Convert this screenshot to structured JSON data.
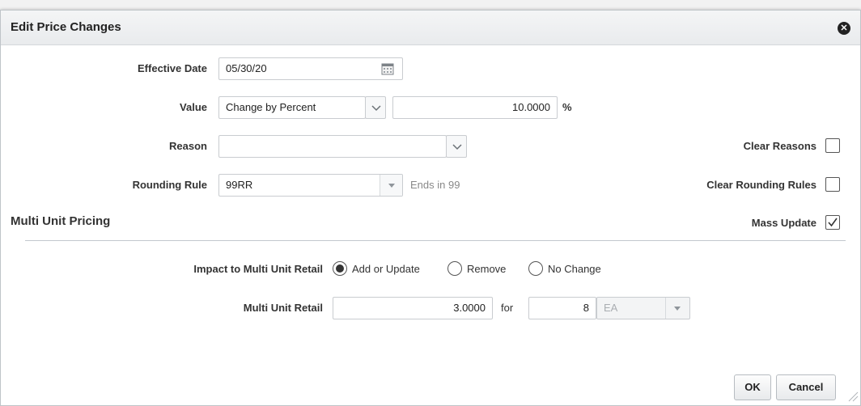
{
  "dialog": {
    "title": "Edit Price Changes",
    "close_glyph": "✕"
  },
  "form": {
    "effective_date": {
      "label": "Effective Date",
      "value": "05/30/20"
    },
    "value": {
      "label": "Value",
      "type_selected": "Change by Percent",
      "amount": "10.0000",
      "unit": "%"
    },
    "reason": {
      "label": "Reason",
      "value": ""
    },
    "rounding_rule": {
      "label": "Rounding Rule",
      "value": "99RR",
      "note": "Ends in 99"
    },
    "clear_reasons": {
      "label": "Clear Reasons",
      "checked": false
    },
    "clear_rounding_rules": {
      "label": "Clear Rounding Rules",
      "checked": false
    },
    "mass_update": {
      "label": "Mass Update",
      "checked": true
    }
  },
  "multi_unit": {
    "section_title": "Multi Unit Pricing",
    "impact": {
      "label": "Impact to Multi Unit Retail",
      "options": [
        {
          "label": "Add or Update",
          "selected": true
        },
        {
          "label": "Remove",
          "selected": false
        },
        {
          "label": "No Change",
          "selected": false
        }
      ]
    },
    "retail": {
      "label": "Multi Unit Retail",
      "amount": "3.0000",
      "for_label": "for",
      "quantity": "8",
      "uom": "EA"
    }
  },
  "buttons": {
    "ok": "OK",
    "cancel": "Cancel"
  },
  "colors": {
    "accent_divider": "#c2c8ce",
    "title_bar": "#e9ebed"
  }
}
